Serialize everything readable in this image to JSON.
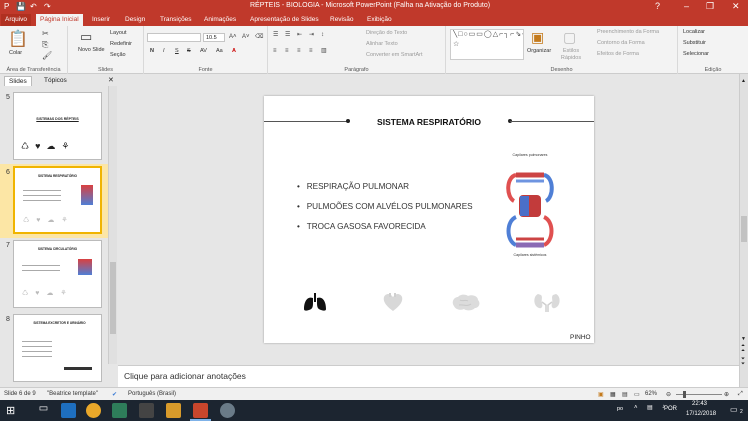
{
  "window": {
    "title": "RÉPTEIS - BIOLOGIA - Microsoft PowerPoint (Falha na Ativação do Produto)",
    "controls": [
      "?",
      "–",
      "❐",
      "✕"
    ]
  },
  "tabs": [
    "Arquivo",
    "Página Inicial",
    "Inserir",
    "Design",
    "Transições",
    "Animações",
    "Apresentação de Slides",
    "Revisão",
    "Exibição"
  ],
  "ribbon": {
    "clipboard": {
      "paste": "Colar",
      "label": "Área de Transferência"
    },
    "slides": {
      "new_slide": "Novo Slide",
      "layout": "Layout",
      "reset": "Redefinir",
      "section": "Seção",
      "label": "Slides"
    },
    "font": {
      "size": "10.5",
      "label": "Fonte",
      "buttons": [
        "N",
        "I",
        "S",
        "S",
        "AV",
        "Aa",
        "A"
      ]
    },
    "paragraph": {
      "text_direction": "Direção do Texto",
      "align_text": "Alinhar Texto",
      "smartart": "Converter em SmartArt",
      "label": "Parágrafo"
    },
    "drawing": {
      "arrange": "Organizar",
      "quick_styles": "Estilos Rápidos",
      "fill": "Preenchimento da Forma",
      "outline": "Contorno da Forma",
      "effects": "Efeitos de Forma",
      "label": "Desenho"
    },
    "editing": {
      "find": "Localizar",
      "replace": "Substituir",
      "select": "Selecionar",
      "label": "Edição"
    }
  },
  "pane": {
    "tab_slides": "Slides",
    "tab_outline": "Tópicos",
    "thumbs": [
      {
        "num": "5",
        "title": "SISTEMAS DOS RÉPTEIS"
      },
      {
        "num": "6",
        "title": "SISTEMA RESPIRATÓRIO"
      },
      {
        "num": "7",
        "title": "SISTEMA CIRCULATÓRIO"
      },
      {
        "num": "8",
        "title": "SISTEMA EXCRETOR E URINÁRIO"
      }
    ]
  },
  "slide": {
    "title": "SISTEMA RESPIRATÓRIO",
    "bullets": [
      "RESPIRAÇÃO PULMONAR",
      "PULMOÕES COM ALVÉLOS PULMONARES",
      "TROCA GASOSA FAVORECIDA"
    ],
    "diagram_top": "Capilares pulmonares",
    "diagram_bottom": "Capilares sistêmicos",
    "footer": "PINHO"
  },
  "notes_placeholder": "Clique para adicionar anotações",
  "status": {
    "slide_info": "Slide 6 de 9",
    "template": "\"Beatrice template\"",
    "language": "Português (Brasil)",
    "zoom": "62%"
  },
  "taskbar": {
    "lang": "POR",
    "time": "22:43",
    "date": "17/12/2018",
    "notif": "2"
  }
}
